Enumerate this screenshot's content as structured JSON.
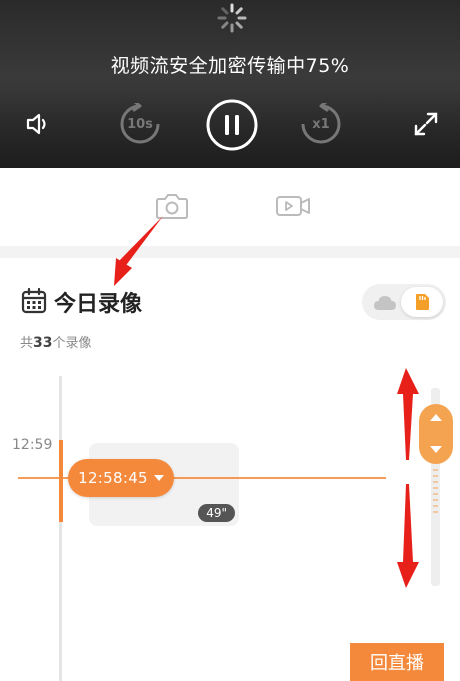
{
  "player": {
    "loading_text": "视频流安全加密传输中75%",
    "rewind_label": "10s",
    "speed_label": "x1",
    "icons": [
      "spinner-icon",
      "volume-icon",
      "rewind-10s-icon",
      "pause-icon",
      "speed-x1-icon",
      "fullscreen-icon"
    ]
  },
  "capture": {
    "icons": [
      "camera-icon",
      "video-record-icon"
    ]
  },
  "recordings": {
    "title": "今日录像",
    "count_prefix": "共",
    "count": "33",
    "count_suffix": "个录像",
    "storage_options": [
      "cloud",
      "sd-card"
    ],
    "selected_storage": "sd-card"
  },
  "timeline": {
    "time_label": "12:59",
    "cursor_time": "12:58:45",
    "clip_duration": "49\""
  },
  "live_button": "回直播",
  "colors": {
    "accent": "#f4893b",
    "annotation": "#e8201a"
  }
}
